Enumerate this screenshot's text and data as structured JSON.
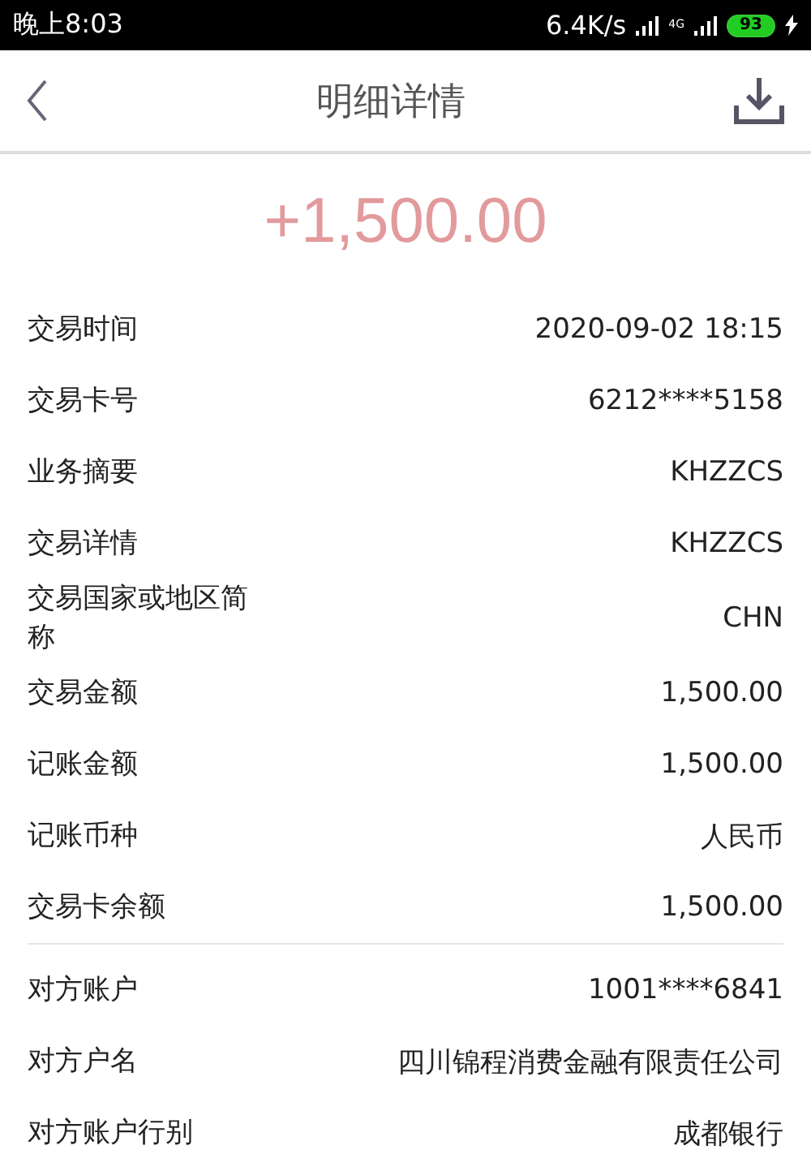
{
  "status_bar": {
    "time": "晚上8:03",
    "speed": "6.4K/s",
    "network": "4G",
    "battery": "93"
  },
  "header": {
    "title": "明细详情"
  },
  "amount": "+1,500.00",
  "sections": [
    {
      "rows": [
        {
          "label": "交易时间",
          "value": "2020-09-02 18:15"
        },
        {
          "label": "交易卡号",
          "value": "6212****5158"
        },
        {
          "label": "业务摘要",
          "value": "KHZZCS"
        },
        {
          "label": "交易详情",
          "value": "KHZZCS"
        },
        {
          "label": "交易国家或地区简称",
          "value": "CHN"
        },
        {
          "label": "交易金额",
          "value": "1,500.00"
        },
        {
          "label": "记账金额",
          "value": "1,500.00"
        },
        {
          "label": "记账币种",
          "value": "人民币"
        },
        {
          "label": "交易卡余额",
          "value": "1,500.00"
        }
      ]
    },
    {
      "rows": [
        {
          "label": "对方账户",
          "value": "1001****6841"
        },
        {
          "label": "对方户名",
          "value": "四川锦程消费金融有限责任公司"
        },
        {
          "label": "对方账户行别",
          "value": "成都银行"
        }
      ]
    }
  ]
}
